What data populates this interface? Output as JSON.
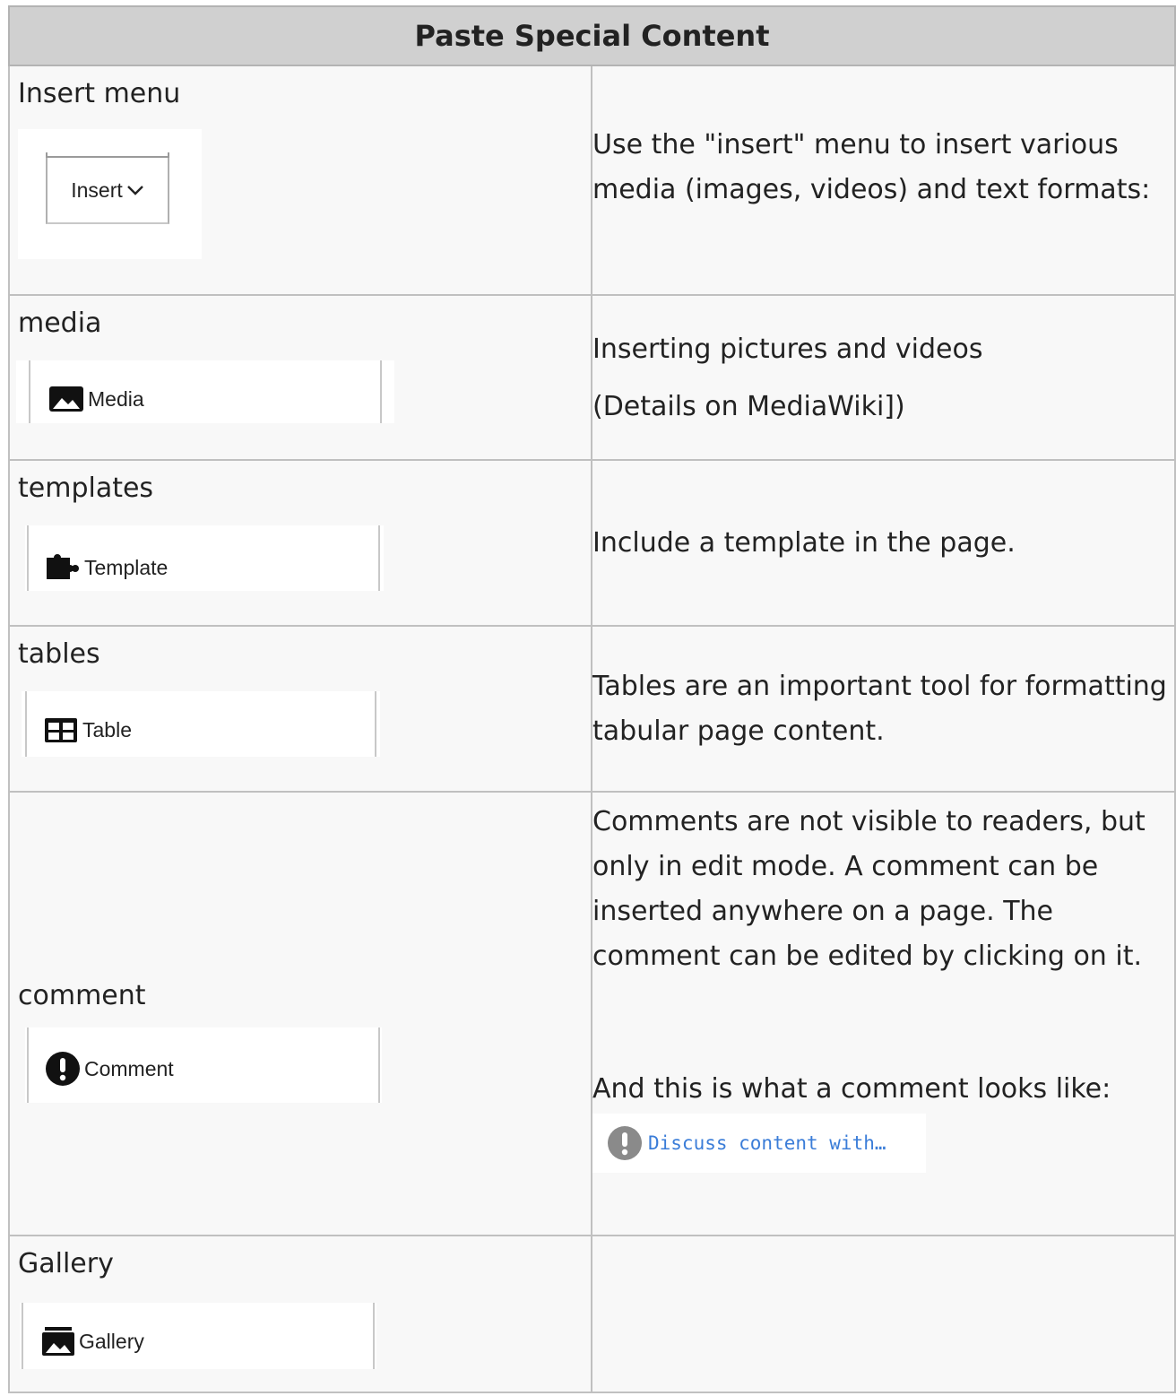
{
  "table": {
    "title": "Paste Special Content",
    "rows": [
      {
        "label": "Insert menu",
        "button_label": "Insert",
        "icon": "chevron-down-icon",
        "description": [
          "Use the \"insert\" menu to insert various media (images, videos) and text formats:"
        ]
      },
      {
        "label": "media",
        "button_label": "Media",
        "icon": "image-icon",
        "description": [
          "Inserting pictures and videos",
          "(Details on MediaWiki])"
        ]
      },
      {
        "label": "templates",
        "button_label": "Template",
        "icon": "puzzle-icon",
        "description": [
          "Include a template in the page."
        ]
      },
      {
        "label": "tables",
        "button_label": "Table",
        "icon": "table-icon",
        "description": [
          "Tables are an important tool for formatting tabular page content."
        ]
      },
      {
        "label": "comment",
        "button_label": "Comment",
        "icon": "exclamation-icon",
        "description": [
          "Comments are not visible to readers, but only in edit mode. A comment can be inserted anywhere on a page. The comment can be edited by clicking on it.",
          "And this is what a comment looks like:"
        ],
        "sample_comment": "Discuss content with…"
      },
      {
        "label": "Gallery",
        "button_label": "Gallery",
        "icon": "gallery-icon",
        "description": []
      }
    ]
  }
}
